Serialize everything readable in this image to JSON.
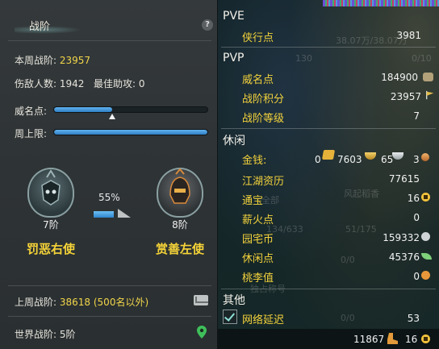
{
  "left": {
    "title": "战阶",
    "help": "?",
    "week_rank_label": "本周战阶:",
    "week_rank_value": "23957",
    "kills_label": "伤敌人数:",
    "kills_value": "1942",
    "best_assist_label": "最佳助攻:",
    "best_assist_value": "0",
    "prestige_label": "威名点:",
    "prestige_fill": 0.38,
    "week_cap_label": "周上限:",
    "week_cap_fill": 1.0,
    "left_emblem_rank": "7阶",
    "left_emblem_name": "罚恶右使",
    "right_emblem_rank": "8阶",
    "right_emblem_name": "赏善左使",
    "progress_pct": "55%",
    "progress_fill": 0.55,
    "last_week_label": "上周战阶:",
    "last_week_value": "38618 (500名以外)",
    "world_label": "世界战阶:",
    "world_value": "5阶"
  },
  "right": {
    "pve_section": "PVE",
    "pve": [
      {
        "label": "侠行点",
        "value": "3981"
      }
    ],
    "pvp_section": "PVP",
    "pvp": [
      {
        "label": "威名点",
        "value": "184900",
        "icon": "mask-icon"
      },
      {
        "label": "战阶积分",
        "value": "23957",
        "icon": "flag-icon"
      },
      {
        "label": "战阶等级",
        "value": "7"
      }
    ],
    "leisure_section": "休闲",
    "money_label": "金钱:",
    "money": {
      "gold_bar": "0",
      "gold": "7603",
      "silver": "65",
      "copper": "3"
    },
    "leisure": [
      {
        "label": "江湖资历",
        "value": "77615"
      },
      {
        "label": "通宝",
        "value": "16",
        "icon": "tongbao-icon"
      },
      {
        "label": "薪火点",
        "value": "0"
      },
      {
        "label": "园宅币",
        "value": "159332",
        "icon": "home-coin-icon"
      },
      {
        "label": "休闲点",
        "value": "45376",
        "icon": "leaf-icon"
      },
      {
        "label": "桃李值",
        "value": "0",
        "icon": "gourd-icon"
      }
    ],
    "other_section": "其他",
    "latency_label": "网络延迟",
    "latency_value": "53",
    "footer_left": "11867",
    "footer_right": "16"
  },
  "background_text": {
    "hp_text": "38.07万/38.07万",
    "n130": "130",
    "n0_10": "0/10",
    "quanbu": "全部",
    "fengqi": "风起稻香",
    "a": "134/633",
    "b": "51/175",
    "c": "0/0",
    "d": "0/0",
    "e": "独占称号"
  },
  "colors": {
    "accent_yellow": "#f3d23c",
    "bar_blue": "#3f92d6",
    "panel_left": "#2f3436",
    "panel_right": "#152829"
  }
}
